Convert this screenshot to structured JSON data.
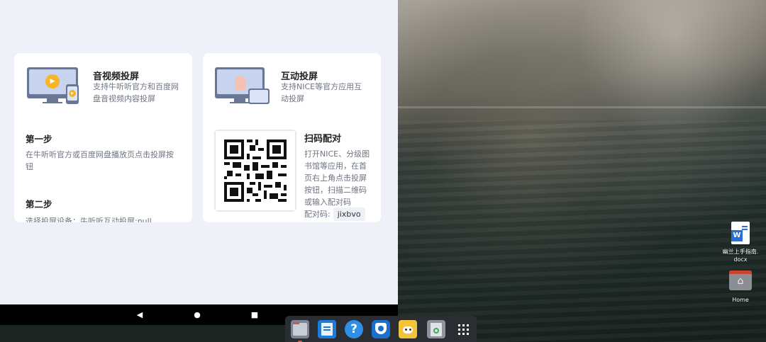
{
  "left_card": {
    "title": "音视频投屏",
    "desc_line1": "支持牛听听官方和百度网",
    "desc_line2": "盘音视频内容投屏",
    "step1_title": "第一步",
    "step1_line1": "在牛听听官方或百度网盘播放页点击投屏按",
    "step1_line2": "钮",
    "step2_title": "第二步",
    "step2_line1": "选择投屏设备：牛听听互动投屏:null"
  },
  "right_card": {
    "title": "互动投屏",
    "desc_line1": "支持NICE等官方应用互",
    "desc_line2": "动投屏",
    "scan_title": "扫码配对",
    "scan_line1": "打开NICE、分级图",
    "scan_line2": "书馆等应用，在首",
    "scan_line3": "页右上角点击投屏",
    "scan_line4": "按钮，扫描二维码",
    "scan_line5": "或输入配对码",
    "pair_label": "配对码:",
    "pair_code": "jixbvo"
  },
  "navbar": {
    "back_glyph": "◀",
    "home_glyph": "●",
    "recents_glyph": "■"
  },
  "dock": {
    "items": [
      "files",
      "document-editor",
      "help",
      "browser",
      "app-store",
      "recycle-bin",
      "app-launcher"
    ],
    "help_glyph": "?",
    "launcher_glyph": "⋮⋮⋮"
  },
  "desktop": {
    "icons": [
      {
        "label_line1": "幽兰上手指南.",
        "label_line2": "docx",
        "icon": "word-doc-icon",
        "glyph": "W"
      },
      {
        "label_line1": "Home",
        "label_line2": "",
        "icon": "home-folder-icon",
        "glyph": "⌂"
      }
    ]
  },
  "colors": {
    "panel_bg": "#eef1f8",
    "card_bg": "#ffffff",
    "accent_play": "#f6b526",
    "word_blue": "#2b6fd6"
  }
}
